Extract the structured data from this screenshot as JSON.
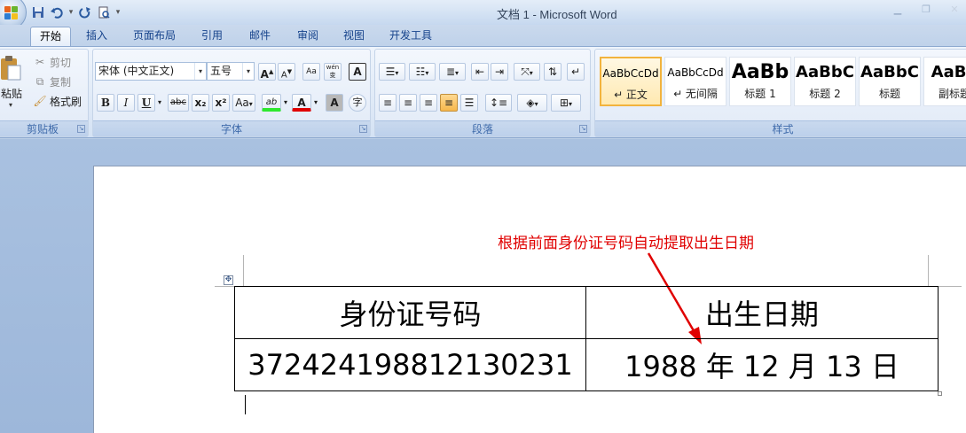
{
  "window": {
    "title": "文档 1 - Microsoft Word",
    "controls": [
      "minimize-icon",
      "restore-icon",
      "close-icon"
    ]
  },
  "quick_access": [
    "save-icon",
    "undo-icon",
    "redo-icon",
    "print-preview-icon"
  ],
  "tabs": [
    {
      "label": "开始",
      "active": true
    },
    {
      "label": "插入"
    },
    {
      "label": "页面布局"
    },
    {
      "label": "引用"
    },
    {
      "label": "邮件"
    },
    {
      "label": "审阅"
    },
    {
      "label": "视图"
    },
    {
      "label": "开发工具"
    }
  ],
  "clipboard": {
    "label": "剪贴板",
    "paste": "粘贴",
    "cut": "剪切",
    "copy": "复制",
    "format_painter": "格式刷"
  },
  "font": {
    "label": "字体",
    "font_name": "宋体 (中文正文)",
    "font_size": "五号",
    "bold": "B",
    "italic": "I",
    "underline": "U",
    "strikethrough": "abc",
    "subscript": "x₂",
    "superscript": "x²",
    "change_case": "Aa",
    "highlight": "ab",
    "font_color": "A",
    "char_shading": "A",
    "enclose": "字",
    "grow": "A",
    "shrink": "A",
    "clear": "Aa",
    "phonetic": "wén 变",
    "border": "A"
  },
  "paragraph": {
    "label": "段落"
  },
  "styles": {
    "label": "样式",
    "items": [
      {
        "sample": "AaBbCcDd",
        "name": "↵ 正文",
        "selected": true
      },
      {
        "sample": "AaBbCcDd",
        "name": "↵ 无间隔"
      },
      {
        "sample": "AaBb",
        "name": "标题 1"
      },
      {
        "sample": "AaBbC",
        "name": "标题 2"
      },
      {
        "sample": "AaBbC",
        "name": "标题"
      },
      {
        "sample": "AaBb",
        "name": "副标题"
      }
    ]
  },
  "document": {
    "annotation": "根据前面身份证号码自动提取出生日期",
    "annotation_color": "#e00000",
    "table": {
      "headers": [
        "身份证号码",
        "出生日期"
      ],
      "id_number": "372424198812130231",
      "birth": {
        "year": "1988",
        "year_unit": "年",
        "month": "12",
        "month_unit": "月",
        "day": "13",
        "day_unit": "日"
      }
    }
  }
}
